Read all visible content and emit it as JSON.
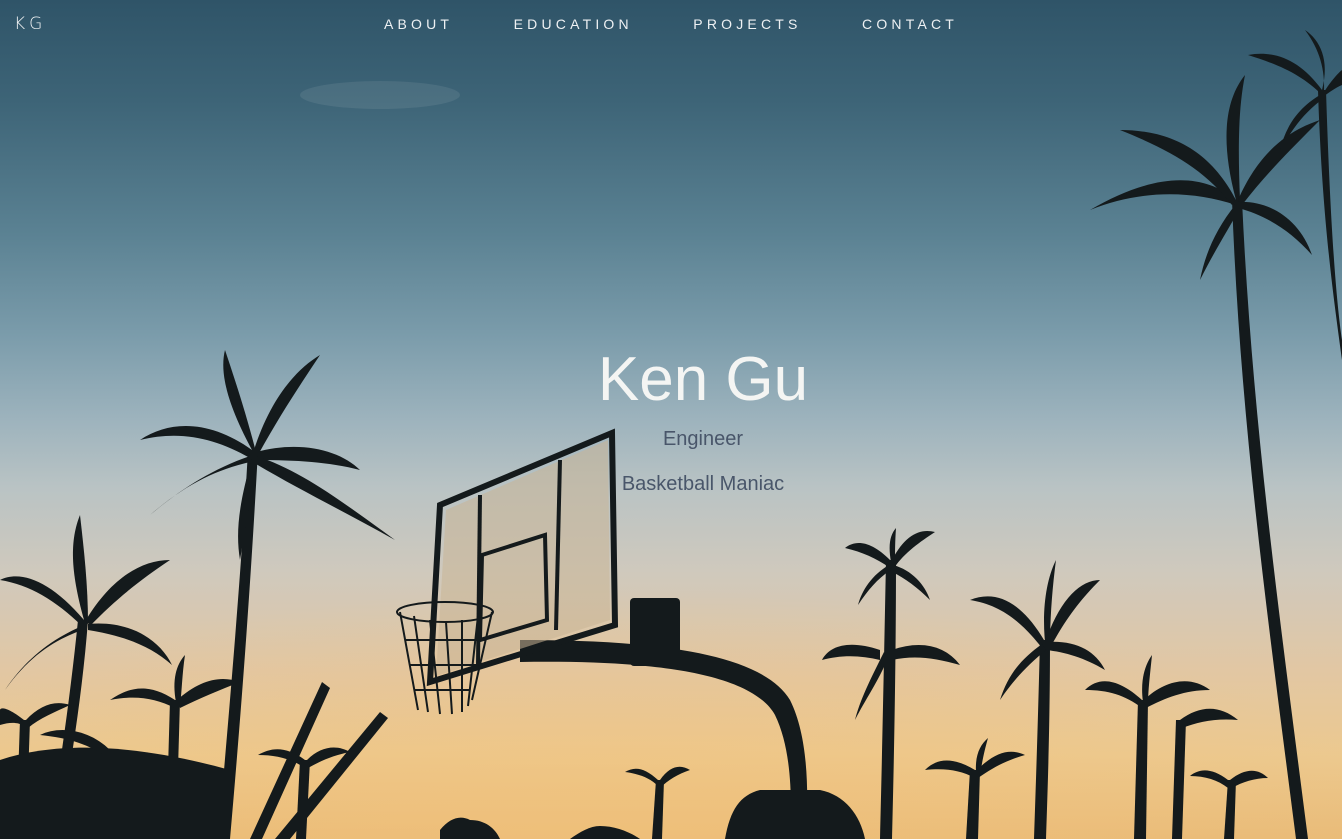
{
  "header": {
    "logo": "KG",
    "nav": [
      {
        "id": "about",
        "label": "ABOUT"
      },
      {
        "id": "education",
        "label": "EDUCATION"
      },
      {
        "id": "projects",
        "label": "PROJECTS"
      },
      {
        "id": "contact",
        "label": "CONTACT"
      }
    ]
  },
  "hero": {
    "name": "Ken Gu",
    "taglines": [
      "Engineer",
      "Basketball Maniac"
    ],
    "background": "sunset sky with palm tree and basketball hoop silhouettes"
  },
  "colors": {
    "sky_top": "#2f5468",
    "sky_bottom": "#e9bb78",
    "silhouette": "#141a1c",
    "nav_text": "#eef1f3",
    "tagline_text": "#49566a"
  }
}
